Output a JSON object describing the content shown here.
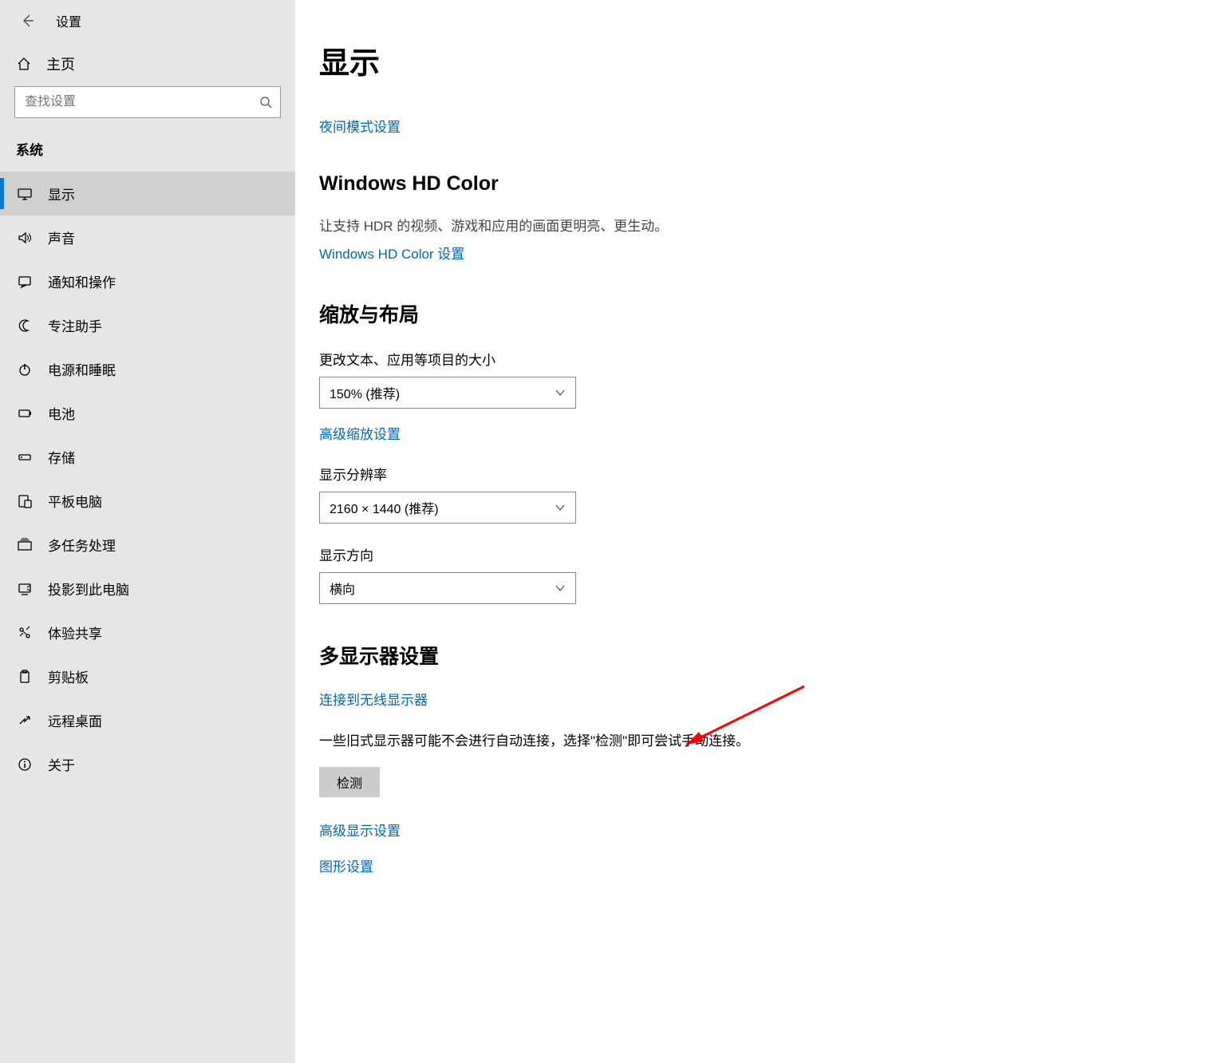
{
  "header": {
    "app_title": "设置"
  },
  "sidebar": {
    "home_label": "主页",
    "search_placeholder": "查找设置",
    "category": "系统",
    "items": [
      {
        "id": "display",
        "label": "显示",
        "active": true
      },
      {
        "id": "sound",
        "label": "声音",
        "active": false
      },
      {
        "id": "notifications",
        "label": "通知和操作",
        "active": false
      },
      {
        "id": "focus",
        "label": "专注助手",
        "active": false
      },
      {
        "id": "power",
        "label": "电源和睡眠",
        "active": false
      },
      {
        "id": "battery",
        "label": "电池",
        "active": false
      },
      {
        "id": "storage",
        "label": "存储",
        "active": false
      },
      {
        "id": "tablet",
        "label": "平板电脑",
        "active": false
      },
      {
        "id": "multitask",
        "label": "多任务处理",
        "active": false
      },
      {
        "id": "project",
        "label": "投影到此电脑",
        "active": false
      },
      {
        "id": "shared",
        "label": "体验共享",
        "active": false
      },
      {
        "id": "clipboard",
        "label": "剪贴板",
        "active": false
      },
      {
        "id": "remote",
        "label": "远程桌面",
        "active": false
      },
      {
        "id": "about",
        "label": "关于",
        "active": false
      }
    ]
  },
  "main": {
    "page_title": "显示",
    "night_light_link": "夜间模式设置",
    "hdcolor": {
      "title": "Windows HD Color",
      "desc": "让支持 HDR 的视频、游戏和应用的画面更明亮、更生动。",
      "link": "Windows HD Color 设置"
    },
    "scaling": {
      "title": "缩放与布局",
      "scale_label": "更改文本、应用等项目的大小",
      "scale_value": "150% (推荐)",
      "adv_scaling_link": "高级缩放设置",
      "resolution_label": "显示分辨率",
      "resolution_value": "2160 × 1440 (推荐)",
      "orientation_label": "显示方向",
      "orientation_value": "横向"
    },
    "multi": {
      "title": "多显示器设置",
      "wireless_link": "连接到无线显示器",
      "detect_desc": "一些旧式显示器可能不会进行自动连接，选择\"检测\"即可尝试手动连接。",
      "detect_btn": "检测",
      "adv_display_link": "高级显示设置",
      "graphics_link": "图形设置"
    }
  }
}
